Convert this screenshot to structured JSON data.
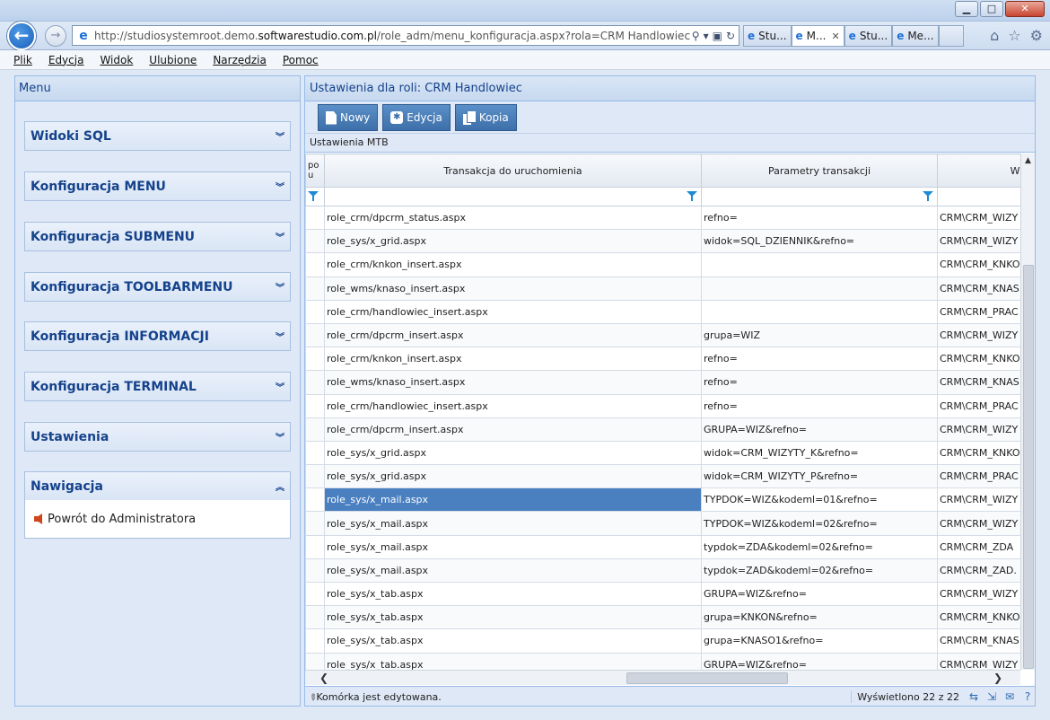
{
  "browser": {
    "url_prefix": "http://studiosystemroot.demo.",
    "url_domain": "softwarestudio.com.pl",
    "url_path": "/role_adm/menu_konfiguracja.aspx?rola=CRM Handlowiec",
    "tabs": [
      {
        "label": "Stu...",
        "active": false
      },
      {
        "label": "M...",
        "active": true
      },
      {
        "label": "Stu...",
        "active": false
      },
      {
        "label": "Me...",
        "active": false
      }
    ]
  },
  "menubar": [
    "Plik",
    "Edycja",
    "Widok",
    "Ulubione",
    "Narzędzia",
    "Pomoc"
  ],
  "left_panel": {
    "title": "Menu",
    "sections": [
      {
        "label": "Widoki SQL"
      },
      {
        "label": "Konfiguracja MENU"
      },
      {
        "label": "Konfiguracja SUBMENU"
      },
      {
        "label": "Konfiguracja TOOLBARMENU"
      },
      {
        "label": "Konfiguracja INFORMACJI"
      },
      {
        "label": "Konfiguracja TERMINAL"
      },
      {
        "label": "Ustawienia"
      },
      {
        "label": "Nawigacja"
      }
    ],
    "nav_link": "Powrót do Administratora"
  },
  "right_panel": {
    "title": "Ustawienia dla roli: CRM Handlowiec",
    "buttons": {
      "new": "Nowy",
      "edit": "Edycja",
      "copy": "Kopia"
    },
    "grid_title": "Ustawienia MTB",
    "columns": {
      "c0": "po\nu",
      "c1": "Transakcja do uruchomienia",
      "c2": "Parametry transakcji",
      "c3": "Widok"
    },
    "rows": [
      [
        "role_crm/dpcrm_status.aspx",
        "refno=",
        "CRM\\CRM_WIZY"
      ],
      [
        "role_sys/x_grid.aspx",
        "widok=SQL_DZIENNIK&refno=",
        "CRM\\CRM_WIZY"
      ],
      [
        "role_crm/knkon_insert.aspx",
        "",
        "CRM\\CRM_KNKO"
      ],
      [
        "role_wms/knaso_insert.aspx",
        "",
        "CRM\\CRM_KNAS"
      ],
      [
        "role_crm/handlowiec_insert.aspx",
        "",
        "CRM\\CRM_PRAC"
      ],
      [
        "role_crm/dpcrm_insert.aspx",
        "grupa=WIZ",
        "CRM\\CRM_WIZY"
      ],
      [
        "role_crm/knkon_insert.aspx",
        "refno=",
        "CRM\\CRM_KNKO"
      ],
      [
        "role_wms/knaso_insert.aspx",
        "refno=",
        "CRM\\CRM_KNAS"
      ],
      [
        "role_crm/handlowiec_insert.aspx",
        "refno=",
        "CRM\\CRM_PRAC"
      ],
      [
        "role_crm/dpcrm_insert.aspx",
        "GRUPA=WIZ&refno=",
        "CRM\\CRM_WIZY"
      ],
      [
        "role_sys/x_grid.aspx",
        "widok=CRM_WIZYTY_K&refno=",
        "CRM\\CRM_KNKO"
      ],
      [
        "role_sys/x_grid.aspx",
        "widok=CRM_WIZYTY_P&refno=",
        "CRM\\CRM_PRAC"
      ],
      [
        "role_sys/x_mail.aspx",
        "TYPDOK=WIZ&kodeml=01&refno=",
        "CRM\\CRM_WIZY"
      ],
      [
        "role_sys/x_mail.aspx",
        "TYPDOK=WIZ&kodeml=02&refno=",
        "CRM\\CRM_WIZY"
      ],
      [
        "role_sys/x_mail.aspx",
        "typdok=ZDA&kodeml=02&refno=",
        "CRM\\CRM_ZDA"
      ],
      [
        "role_sys/x_mail.aspx",
        "typdok=ZAD&kodeml=02&refno=",
        "CRM\\CRM_ZAD."
      ],
      [
        "role_sys/x_tab.aspx",
        "GRUPA=WIZ&refno=",
        "CRM\\CRM_WIZY"
      ],
      [
        "role_sys/x_tab.aspx",
        "grupa=KNKON&refno=",
        "CRM\\CRM_KNKO"
      ],
      [
        "role_sys/x_tab.aspx",
        "grupa=KNASO1&refno=",
        "CRM\\CRM_KNAS"
      ],
      [
        "role_sys/x_tab.aspx",
        "GRUPA=WIZ&refno=",
        "CRM\\CRM_WIZY"
      ]
    ],
    "selected_row": 12,
    "status_text": "Komórka jest edytowana.",
    "count_text": "Wyświetlono 22 z 22"
  }
}
